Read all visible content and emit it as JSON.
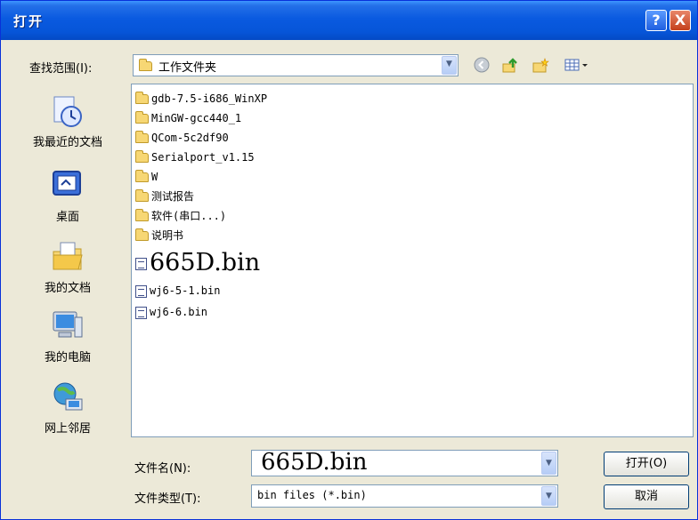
{
  "window": {
    "title": "打开"
  },
  "titlebar": {
    "help_label": "?",
    "close_label": "X"
  },
  "lookin": {
    "label": "查找范围(I):",
    "value": "工作文件夹"
  },
  "places": [
    {
      "label": "我最近的文档",
      "icon": "recent-documents-icon"
    },
    {
      "label": "桌面",
      "icon": "desktop-icon"
    },
    {
      "label": "我的文档",
      "icon": "my-documents-icon"
    },
    {
      "label": "我的电脑",
      "icon": "my-computer-icon"
    },
    {
      "label": "网上邻居",
      "icon": "network-places-icon"
    }
  ],
  "files": [
    {
      "name": "gdb-7.5-i686_WinXP",
      "type": "folder"
    },
    {
      "name": "MinGW-gcc440_1",
      "type": "folder"
    },
    {
      "name": "QCom-5c2df90",
      "type": "folder"
    },
    {
      "name": "Serialport_v1.15",
      "type": "folder"
    },
    {
      "name": "W",
      "type": "folder"
    },
    {
      "name": "测试报告",
      "type": "folder"
    },
    {
      "name": "软件(串口...)",
      "type": "folder"
    },
    {
      "name": "说明书",
      "type": "folder"
    },
    {
      "name": "665D.bin",
      "type": "bin"
    },
    {
      "name": "wj6-5-1.bin",
      "type": "bin"
    },
    {
      "name": "wj6-6.bin",
      "type": "bin"
    }
  ],
  "filename": {
    "label": "文件名(N):",
    "value": "665D.bin"
  },
  "filetype": {
    "label": "文件类型(T):",
    "value": "bin files (*.bin)"
  },
  "buttons": {
    "open": "打开(O)",
    "cancel": "取消"
  }
}
